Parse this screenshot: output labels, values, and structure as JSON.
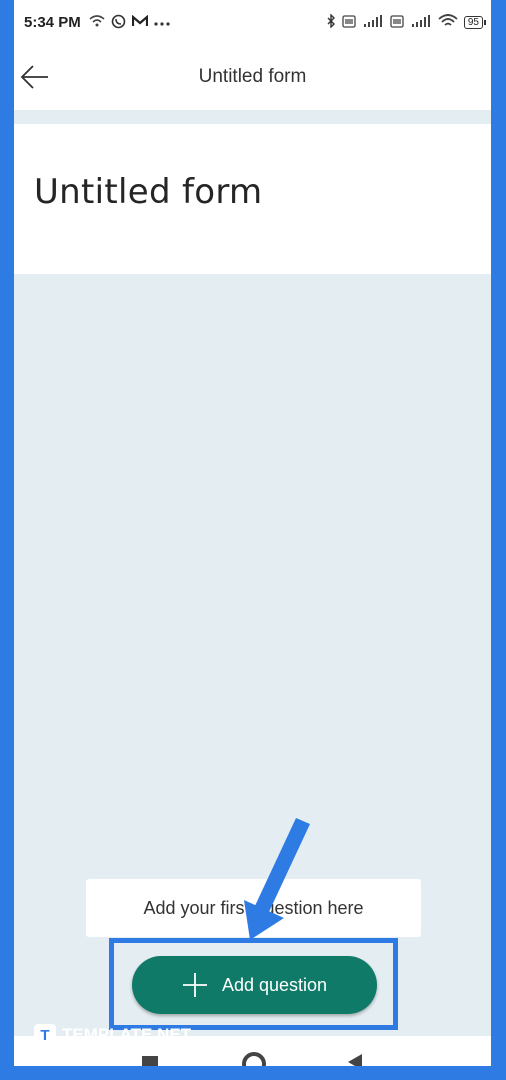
{
  "status_bar": {
    "time": "5:34 PM",
    "left_icons": [
      "wifi-icon",
      "whatsapp-icon",
      "gmail-icon",
      "more-icon"
    ],
    "right_icons": [
      "bluetooth-icon",
      "volte-icon",
      "signal-icon",
      "volte-icon",
      "signal-icon",
      "wifi-icon"
    ],
    "battery": "95"
  },
  "app_bar": {
    "title": "Untitled form",
    "back_icon": "arrow-left-icon"
  },
  "form": {
    "title": "Untitled form"
  },
  "hint": {
    "text": "Add your first question here"
  },
  "add_button": {
    "label": "Add question",
    "icon": "plus-icon",
    "color": "#0f7a67"
  },
  "watermark": {
    "logo_letter": "T",
    "text": "TEMPLATE.NET"
  },
  "colors": {
    "frame_border": "#2e7be4",
    "canvas": "#e4eef2",
    "annotation": "#2e7be4"
  }
}
